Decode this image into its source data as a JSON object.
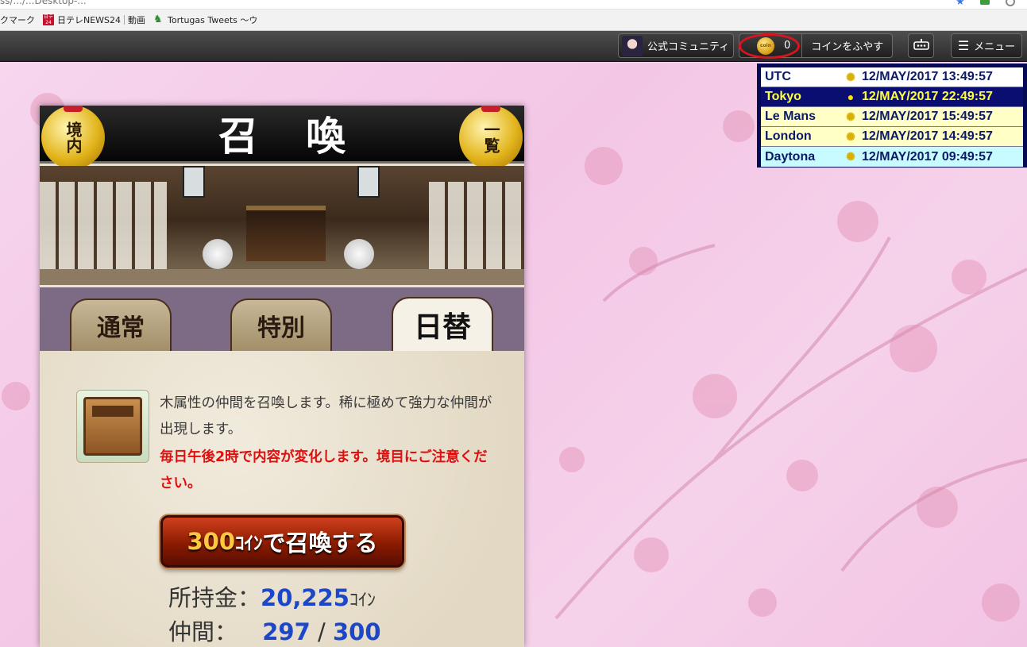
{
  "browser": {
    "url_fragment": "ss/.../...Desktop-...",
    "bookmarks": [
      {
        "label": "クマーク"
      },
      {
        "label": "日テレNEWS24",
        "icon": "ntv-news-icon"
      },
      {
        "label": "動画"
      },
      {
        "label": "Tortugas Tweets 〜ウ",
        "icon": "tortoise-icon"
      }
    ]
  },
  "toolbar": {
    "community_label": "公式コミュニティ",
    "coin_count": "0",
    "coin_icon_text": "coin",
    "increase_coins_label": "コインをふやす",
    "menu_label": "メニュー"
  },
  "clock": {
    "rows": [
      {
        "city": "UTC",
        "icon": "sun-icon",
        "time": "12/MAY/2017 13:49:57"
      },
      {
        "city": "Tokyo",
        "icon": "moon-icon",
        "time": "12/MAY/2017 22:49:57"
      },
      {
        "city": "Le Mans",
        "icon": "sun-icon",
        "time": "12/MAY/2017 15:49:57"
      },
      {
        "city": "London",
        "icon": "sun-icon",
        "time": "12/MAY/2017 14:49:57"
      },
      {
        "city": "Daytona",
        "icon": "sun-icon",
        "time": "12/MAY/2017 09:49:57"
      }
    ]
  },
  "summon": {
    "title": "召喚",
    "bell_left": "境内",
    "bell_right": "一覧",
    "tabs": [
      {
        "label": "通常"
      },
      {
        "label": "特別"
      },
      {
        "label": "日替",
        "active": true
      }
    ],
    "description": "木属性の仲間を召喚します。稀に極めて強力な仲間が出現します。",
    "warning": "毎日午後2時で内容が変化します。境目にご注意ください。",
    "button_price": "300",
    "button_unit": "ｺｲﾝ",
    "button_text": "で召喚する",
    "money_label": "所持金：",
    "money_value": "20,225",
    "money_unit": "ｺｲﾝ",
    "members_label": "仲間：",
    "members_current": "297",
    "members_sep": " / ",
    "members_max": "300"
  },
  "colors": {
    "toolbar_bg": "#2b2b2b",
    "clock_border": "#060a55",
    "warning_red": "#e00f0f",
    "value_blue": "#1d47c9",
    "button_red": "#8a1b00",
    "background_pink": "#f6d3ec"
  }
}
